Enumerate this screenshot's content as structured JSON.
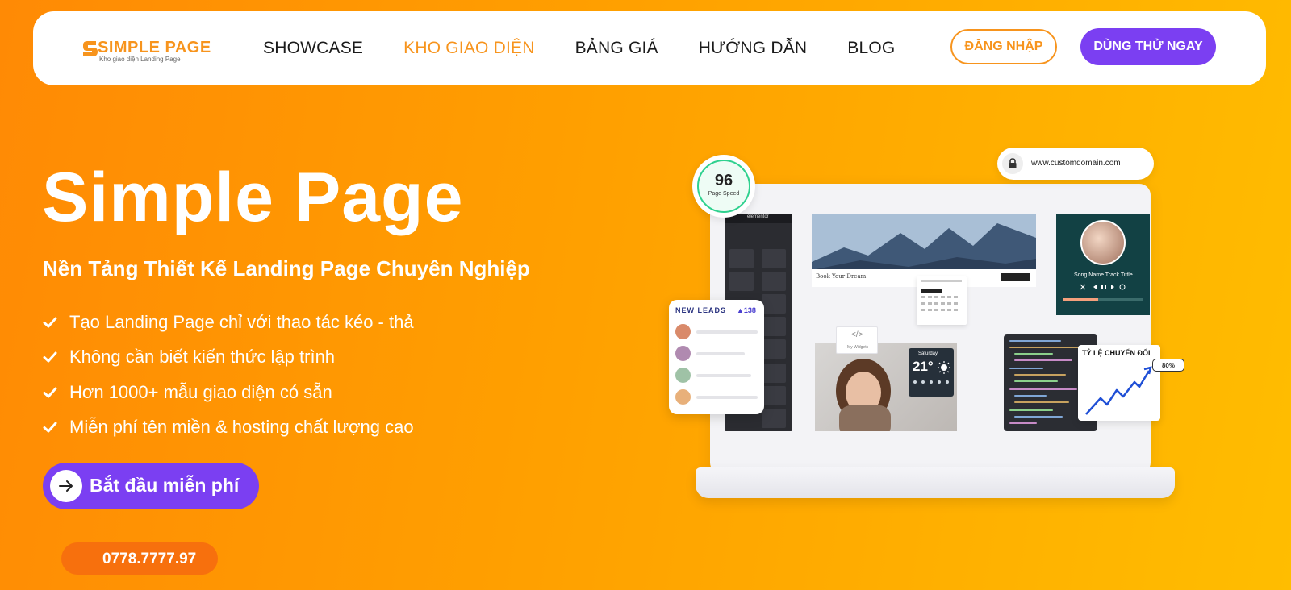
{
  "header": {
    "logo": {
      "name": "SIMPLE PAGE",
      "tagline": "Kho giao diện Landing Page"
    },
    "menu": [
      {
        "label": "SHOWCASE",
        "active": false
      },
      {
        "label": "KHO GIAO DIỆN",
        "active": true
      },
      {
        "label": "BẢNG GIÁ",
        "active": false
      },
      {
        "label": "HƯỚNG DẪN",
        "active": false
      },
      {
        "label": "BLOG",
        "active": false
      }
    ],
    "login_label": "ĐĂNG NHẬP",
    "try_label": "DÙNG THỬ NGAY"
  },
  "hero": {
    "title": "Simple Page",
    "subtitle": "Nền Tảng Thiết Kế Landing Page Chuyên Nghiệp",
    "features": [
      "Tạo Landing Page chỉ với thao tác kéo - thả",
      "Không cần biết kiến thức lập trình",
      "Hơn 1000+ mẫu giao diện có sẵn",
      "Miễn phí tên miền & hosting chất lượng cao"
    ],
    "cta_label": "Bắt đầu miễn phí",
    "phone": "0778.7777.97"
  },
  "mockup": {
    "page_speed_value": "96",
    "page_speed_label": "Page Speed",
    "domain": "www.customdomain.com",
    "new_leads_label": "NEW LEADS",
    "new_leads_count": "▲138",
    "conversion_label": "TỶ LỆ CHUYỂN ĐỔI",
    "conversion_value": "80%",
    "editor_label": "elementor",
    "booking_label": "Book Your Dream",
    "song_label": "Song Name  Track Tittle",
    "widget_label": "My Widgets",
    "weather_day": "Saturday",
    "weather_temp": "21°"
  },
  "colors": {
    "accent_orange": "#f7941d",
    "purple": "#7b3ff2",
    "bg_start": "#ff8a05",
    "bg_end": "#ffbd00"
  }
}
